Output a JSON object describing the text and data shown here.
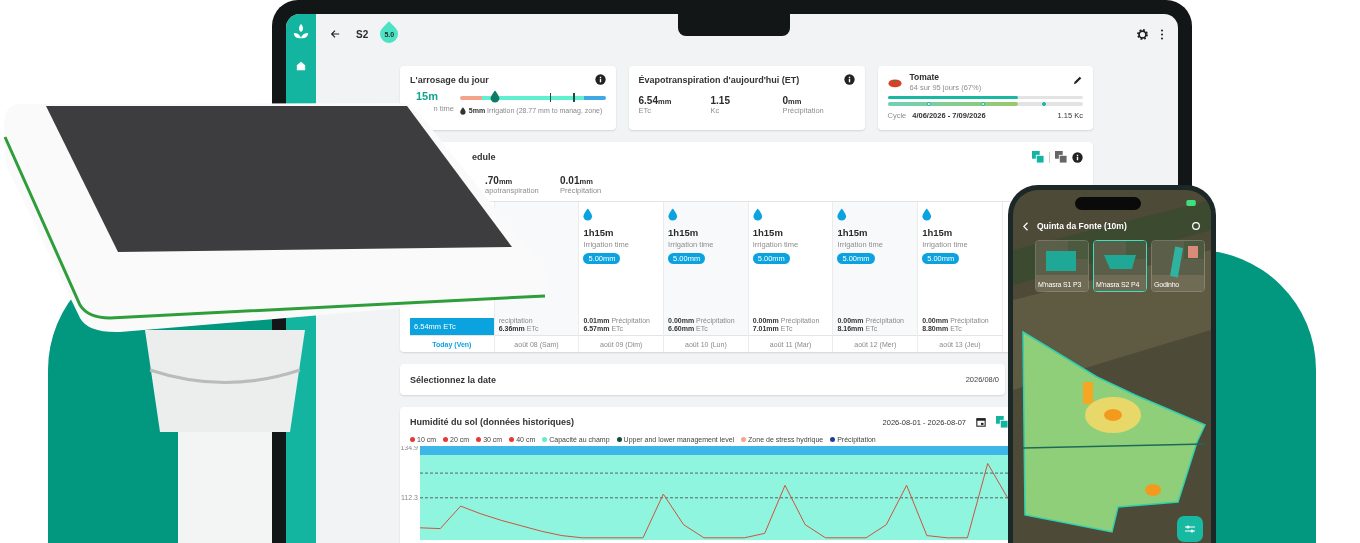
{
  "header": {
    "title": "S2",
    "badge": "5.0"
  },
  "watering": {
    "title": "L'arrosage du jour",
    "time_value": "15m",
    "time_label": "n time",
    "level": 0.24,
    "note": "**5mm** Irrigation (28.77 mm to manag. zone)"
  },
  "et": {
    "title": "Évapotranspiration d'aujourd'hui (ET)",
    "stats": [
      {
        "value": "6.54",
        "unit": "mm",
        "label": "ETc"
      },
      {
        "value": "1.15",
        "label": "Kc"
      },
      {
        "value": "0",
        "unit": "mm",
        "label": "Précipitation"
      }
    ]
  },
  "crop": {
    "name": "Tomate",
    "progress": "64 sur 95 jours (67%)",
    "level": 0.67,
    "cycle_label": "Cycle",
    "cycle": "4/06/2026 - 7/09/2026",
    "kc": "1.15 Kc"
  },
  "schedule": {
    "title": "edule",
    "stats": [
      {
        "value": ".70",
        "unit": "mm",
        "label": "apotranspiration"
      },
      {
        "value": "0.01",
        "unit": "mm",
        "label": "Précipitation"
      }
    ],
    "days": [
      {
        "date": "Today (Ven)",
        "selected": true,
        "etc": "6.54mm ETc"
      },
      {
        "date": "août 08 (Sam)",
        "selected": false,
        "precipitation": "recipitation",
        "etc": "**6.36mm** ETc"
      },
      {
        "date": "août 09 (Dim)",
        "selected": false,
        "duration": "1h15m",
        "duration_label": "Irrigation time",
        "amount": "5.00mm",
        "precipitation": "**0.01mm** Précipitation",
        "etc": "**6.57mm** ETc"
      },
      {
        "date": "août 10 (Lun)",
        "selected": false,
        "duration": "1h15m",
        "duration_label": "Irrigation time",
        "amount": "5.00mm",
        "precipitation": "**0.00mm** Précipitation",
        "etc": "**6.60mm** ETc"
      },
      {
        "date": "août 11 (Mar)",
        "selected": false,
        "duration": "1h15m",
        "duration_label": "Irrigation time",
        "amount": "5.00mm",
        "precipitation": "**0.00mm** Précipitation",
        "etc": "**7.01mm** ETc"
      },
      {
        "date": "août 12 (Mer)",
        "selected": false,
        "duration": "1h15m",
        "duration_label": "Irrigation time",
        "amount": "5.00mm",
        "precipitation": "**0.00mm** Précipitation",
        "etc": "**8.16mm** ETc"
      },
      {
        "date": "août 13 (Jeu)",
        "selected": false,
        "duration": "1h15m",
        "duration_label": "Irrigation time",
        "amount": "5.00mm",
        "precipitation": "**0.00mm** Précipitation",
        "etc": "**8.80mm** ETc"
      }
    ]
  },
  "date_select": {
    "label": "Sélectionnez la date",
    "value": "2026/08/0"
  },
  "soil": {
    "title": "Humidité du sol (données historiques)",
    "range": "2026-08-01 - 2026-08-07",
    "legend": [
      {
        "name": "10 cm",
        "color": "#e53935"
      },
      {
        "name": "20 cm",
        "color": "#e53935"
      },
      {
        "name": "30 cm",
        "color": "#e53935"
      },
      {
        "name": "40 cm",
        "color": "#e53935"
      },
      {
        "name": "Capacité au champ",
        "color": "#5fefd0"
      },
      {
        "name": "Upper and lower management level",
        "color": "#0d4f3c"
      },
      {
        "name": "Zone de stress hydrique",
        "color": "#f4a58a"
      },
      {
        "name": "Précipitation",
        "color": "#1a3f9e"
      }
    ],
    "chart_data": {
      "type": "line",
      "ylim": [
        93,
        136
      ],
      "yticks": [
        112.3,
        134.9
      ],
      "series": [
        {
          "color": "#d0533f",
          "values": [
            98.6,
            98.2,
            108.5,
            105,
            102,
            99.5,
            97,
            95,
            94,
            94,
            94,
            94,
            114,
            100,
            94,
            94,
            94,
            96,
            118,
            100,
            94,
            94,
            94,
            100,
            118,
            95,
            94,
            94,
            128,
            112
          ]
        }
      ]
    }
  },
  "phone": {
    "title": "Quinta da Fonte (10m)",
    "fields": [
      {
        "name": "M'nasra S1 P3",
        "selected": false
      },
      {
        "name": "M'nasra S2 P4",
        "selected": true
      },
      {
        "name": "Godinho",
        "selected": false
      }
    ]
  }
}
